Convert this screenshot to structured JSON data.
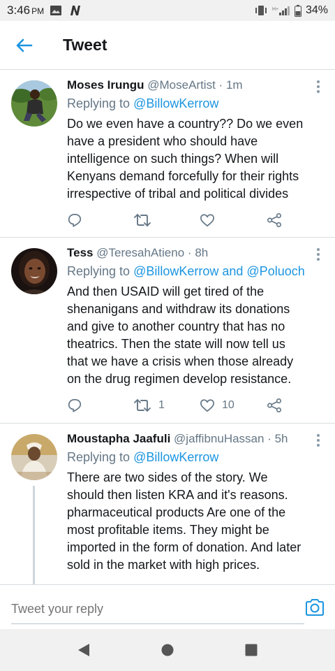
{
  "status_bar": {
    "time": "3:46",
    "ampm": "PM",
    "battery": "34%",
    "icons": [
      "image-icon",
      "n-app-icon",
      "vibrate-icon",
      "signal-icon",
      "battery-icon"
    ]
  },
  "header": {
    "title": "Tweet",
    "back_icon": "arrow-left-icon"
  },
  "tweets": [
    {
      "name": "Moses Irungu",
      "handle": "@MoseArtist",
      "time": "1m",
      "replying_prefix": "Replying to",
      "replying_to": "@BillowKerrow",
      "text": "Do we even have a country?? Do we even have a president who should have intelligence on such things? When will Kenyans demand forcefully for their rights irrespective of tribal and political divides",
      "retweets": "",
      "likes": ""
    },
    {
      "name": "Tess",
      "handle": "@TeresahAtieno",
      "time": "8h",
      "replying_prefix": "Replying to",
      "replying_to": "@BillowKerrow and @Poluoch",
      "text": "And then USAID will get tired of the shenanigans and withdraw its donations and give to another country that has no theatrics. Then the state will now tell us that we have a crisis when those already on the drug regimen develop resistance.",
      "retweets": "1",
      "likes": "10"
    },
    {
      "name": "Moustapha Jaafuli",
      "handle": "@jaffibnuHassan",
      "time": "5h",
      "replying_prefix": "Replying to",
      "replying_to": "@BillowKerrow",
      "text": "There are two sides of the story. We should then listen KRA and it's reasons. pharmaceutical  products Are one of the most profitable items. They might be imported in the form of donation. And later sold in the market with high prices.",
      "retweets": "",
      "likes": ""
    }
  ],
  "reply_bar": {
    "placeholder": "Tweet your reply",
    "camera_icon": "camera-icon"
  },
  "nav_bar": {
    "icons": [
      "back-triangle-icon",
      "home-circle-icon",
      "recents-square-icon"
    ]
  },
  "colors": {
    "accent": "#1b95e0",
    "text": "#14171a",
    "secondary": "#657786",
    "border": "#d9dde0"
  }
}
